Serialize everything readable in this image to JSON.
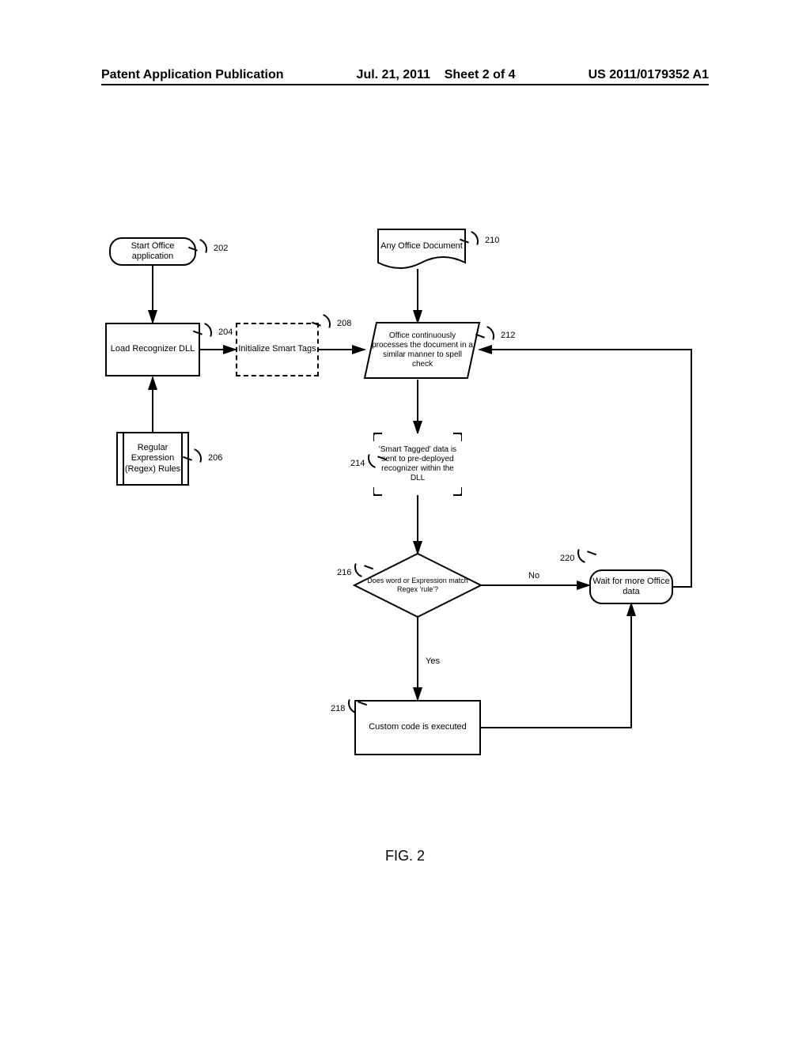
{
  "header": {
    "left": "Patent Application Publication",
    "date": "Jul. 21, 2011",
    "sheet": "Sheet 2 of 4",
    "pubno": "US 2011/0179352 A1"
  },
  "figure_caption": "FIG. 2",
  "nodes": {
    "n202": {
      "label": "202",
      "text": "Start Office application"
    },
    "n204": {
      "label": "204",
      "text": "Load Recognizer DLL"
    },
    "n206": {
      "label": "206",
      "text": "Regular Expression (Regex) Rules"
    },
    "n208": {
      "label": "208",
      "text": "Initialize Smart Tags"
    },
    "n210": {
      "label": "210",
      "text": "Any Office Document"
    },
    "n212": {
      "label": "212",
      "text": "Office continuously processes the document in a similar manner to spell check"
    },
    "n214": {
      "label": "214",
      "text": "'Smart Tagged' data is sent to pre-deployed recognizer within the DLL"
    },
    "n216": {
      "label": "216",
      "text": "Does word or Expression match Regex 'rule'?"
    },
    "n218": {
      "label": "218",
      "text": "Custom code is executed"
    },
    "n220": {
      "label": "220",
      "text": "Wait for more Office data"
    }
  },
  "edges": {
    "yes": "Yes",
    "no": "No"
  }
}
